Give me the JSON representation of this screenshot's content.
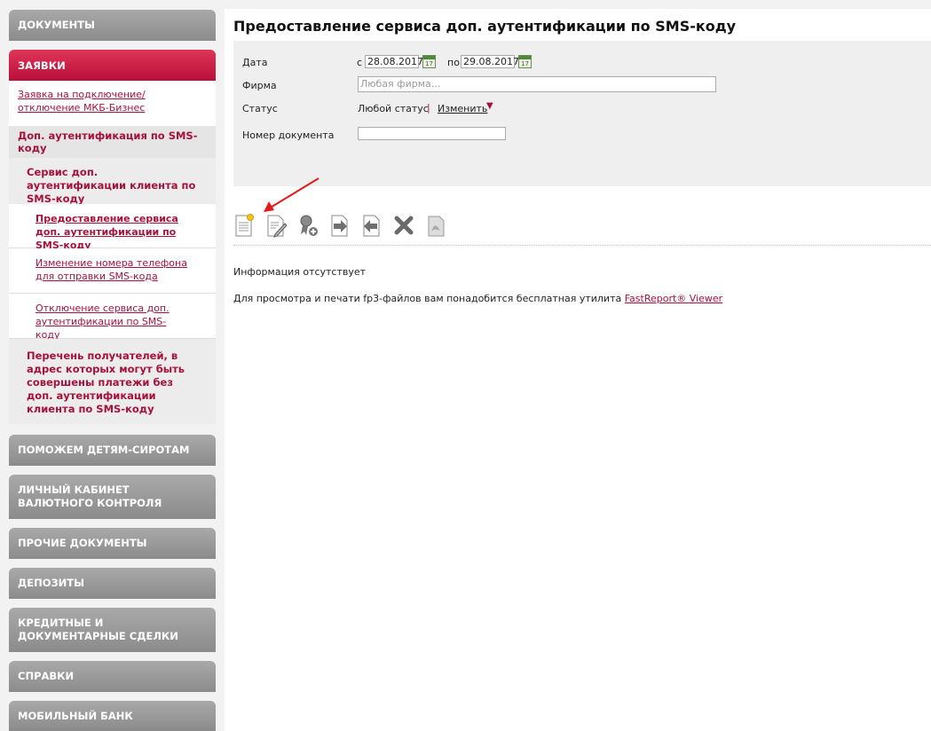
{
  "sidebar": {
    "documents": "ДОКУМЕНТЫ",
    "requests": "ЗАЯВКИ",
    "mkb_link": "Заявка на подключение/отключение МКБ-Бизнес",
    "sms_auth": "Доп. аутентификация по SMS-коду",
    "sms_service": "Сервис доп. аутентификации клиента по SMS-коду",
    "items": [
      {
        "label": "Предоставление сервиса доп. аутентификации по SMS-коду"
      },
      {
        "label": "Изменение номера телефона для отправки SMS-кода"
      },
      {
        "label": "Отключение сервиса доп. аутентификации по SMS-коду"
      }
    ],
    "recipients": "Перечень получателей, в адрес которых могут быть совершены платежи без доп. аутентификации клиента по SMS-коду",
    "sections": [
      {
        "label": "ПОМОЖЕМ ДЕТЯМ-СИРОТАМ"
      },
      {
        "label": "ЛИЧНЫЙ КАБИНЕТ ВАЛЮТНОГО КОНТРОЛЯ"
      },
      {
        "label": "ПРОЧИЕ ДОКУМЕНТЫ"
      },
      {
        "label": "ДЕПОЗИТЫ"
      },
      {
        "label": "КРЕДИТНЫЕ И ДОКУМЕНТАРНЫЕ СДЕЛКИ"
      },
      {
        "label": "СПРАВКИ"
      },
      {
        "label": "МОБИЛЬНЫЙ БАНК"
      }
    ]
  },
  "main": {
    "title": "Предоставление сервиса доп. аутентификации по SMS-коду",
    "filter": {
      "date_label": "Дата",
      "from_prefix": "с",
      "from_value": "28.08.2017",
      "to_prefix": "по",
      "to_value": "29.08.2017",
      "calendar_day": "17",
      "firm_label": "Фирма",
      "firm_placeholder": "Любая фирма...",
      "status_label": "Статус",
      "status_value": "Любой статус",
      "status_sep": "|",
      "status_change": "Изменить",
      "docnum_label": "Номер документа",
      "docnum_value": ""
    },
    "no_info": "Информация отсутствует",
    "viewer_text": "Для просмотра и печати fp3-файлов вам понадобится бесплатная утилита",
    "viewer_link": "FastReport® Viewer"
  },
  "colors": {
    "accent": "#a5133c",
    "arrow": "#e41b1b"
  }
}
